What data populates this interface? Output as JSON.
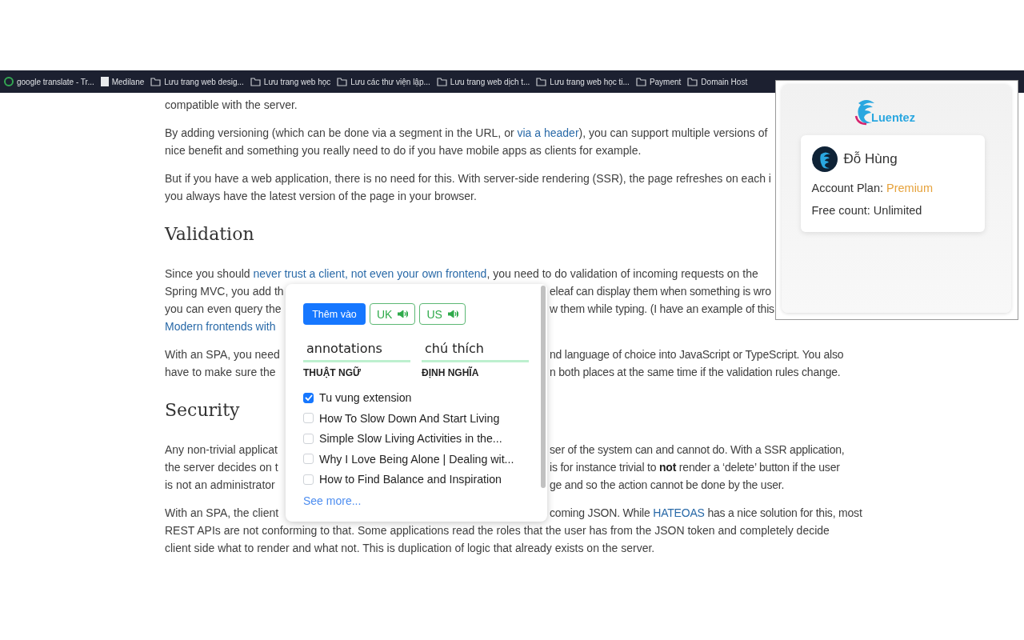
{
  "bookmarks_bar": {
    "items": [
      {
        "kind": "site",
        "label": "google translate - Tr..."
      },
      {
        "kind": "page",
        "label": "Medilane"
      },
      {
        "kind": "folder",
        "label": "Lưu trang web desig..."
      },
      {
        "kind": "folder",
        "label": "Lưu trang web học"
      },
      {
        "kind": "folder",
        "label": "Lưu các thư viện lập..."
      },
      {
        "kind": "folder",
        "label": "Lưu trang web dịch t..."
      },
      {
        "kind": "folder",
        "label": "Lưu trang web học ti..."
      },
      {
        "kind": "folder",
        "label": "Payment"
      },
      {
        "kind": "folder",
        "label": "Domain Host"
      }
    ]
  },
  "article": {
    "blocks": [
      {
        "kind": "paragraph",
        "lines": [
          {
            "parts": [
              {
                "kind": "text",
                "text": "compatible with the server."
              }
            ]
          }
        ]
      },
      {
        "kind": "paragraph",
        "lines": [
          {
            "parts": [
              {
                "kind": "text",
                "text": "By adding versioning (which can be done via a segment in the URL, or "
              },
              {
                "kind": "link",
                "text": "via a header"
              },
              {
                "kind": "text",
                "text": "), you can support multiple versions of"
              }
            ]
          },
          {
            "parts": [
              {
                "kind": "text",
                "text": "nice benefit and something you really need to do if you have mobile apps as clients for example."
              }
            ]
          }
        ]
      },
      {
        "kind": "paragraph",
        "lines": [
          {
            "parts": [
              {
                "kind": "text",
                "text": "But if you have a web application, there is no need for this. With server-side rendering (SSR), the page refreshes on each i"
              }
            ]
          },
          {
            "parts": [
              {
                "kind": "text",
                "text": "you always have the latest version of the page in your browser."
              }
            ]
          }
        ]
      },
      {
        "kind": "heading",
        "text": "Validation"
      },
      {
        "kind": "paragraph",
        "lines": [
          {
            "parts": [
              {
                "kind": "text",
                "text": "Since you should "
              },
              {
                "kind": "link",
                "text": "never trust a client, not even your own frontend"
              },
              {
                "kind": "text",
                "text": ", you need to do validation of incoming requests on the"
              }
            ]
          },
          {
            "parts": [
              {
                "kind": "text",
                "text": "Spring MVC, you add th"
              }
            ],
            "right_parts": [
              {
                "kind": "text",
                "text": "eleaf can display them when something is wro"
              }
            ]
          },
          {
            "parts": [
              {
                "kind": "text",
                "text": "you can even query the"
              }
            ],
            "right_parts": [
              {
                "kind": "text",
                "text": "w them while typing. (I have an example of this"
              }
            ]
          },
          {
            "parts": [
              {
                "kind": "link",
                "text": "Modern frontends with"
              }
            ]
          }
        ]
      },
      {
        "kind": "paragraph",
        "lines": [
          {
            "parts": [
              {
                "kind": "text",
                "text": "With an SPA, you need"
              }
            ],
            "right_parts": [
              {
                "kind": "text",
                "text": "nd language of choice into JavaScript or TypeScript. You also"
              }
            ]
          },
          {
            "parts": [
              {
                "kind": "text",
                "text": "have to make sure the"
              }
            ],
            "right_parts": [
              {
                "kind": "text",
                "text": "n both places at the same time if the validation rules change."
              }
            ]
          }
        ]
      },
      {
        "kind": "heading",
        "text": "Security"
      },
      {
        "kind": "paragraph",
        "lines": [
          {
            "parts": [
              {
                "kind": "text",
                "text": "Any non-trivial applicat"
              }
            ],
            "right_parts": [
              {
                "kind": "text",
                "text": "ser of the system can and cannot do. With a SSR application,"
              }
            ]
          },
          {
            "parts": [
              {
                "kind": "text",
                "text": "the server decides on t"
              }
            ],
            "right_parts": [
              {
                "kind": "text",
                "text": "is for instance trivial to **not** render a ‘delete’ button if the user"
              }
            ]
          },
          {
            "parts": [
              {
                "kind": "text",
                "text": "is not an administrator"
              }
            ],
            "right_parts": [
              {
                "kind": "text",
                "text": "ge and so the action cannot be done by the user."
              }
            ]
          }
        ]
      },
      {
        "kind": "paragraph",
        "lines": [
          {
            "parts": [
              {
                "kind": "text",
                "text": "With an SPA, the client"
              }
            ],
            "right_parts": [
              {
                "kind": "text",
                "text": "coming JSON. While "
              },
              {
                "kind": "link",
                "text": "HATEOAS"
              },
              {
                "kind": "text",
                "text": " has a nice solution for this, most"
              }
            ]
          },
          {
            "parts": [
              {
                "kind": "text",
                "text": "REST APIs are not conforming to that. Some applications read the roles that the user has from the JSON token and completely decide"
              }
            ]
          },
          {
            "parts": [
              {
                "kind": "text",
                "text": "client side what to render and what not. This is duplication of logic that already exists on the server."
              }
            ]
          }
        ]
      }
    ]
  },
  "word_popup": {
    "add_button": "Thêm vào",
    "pronunciations": [
      {
        "label": "UK"
      },
      {
        "label": "US"
      }
    ],
    "term": {
      "value": "annotations",
      "label": "THUẬT NGỮ"
    },
    "definition": {
      "value": "chú thích",
      "label": "ĐỊNH NGHĨA"
    },
    "lists": [
      {
        "label": "Tu vung extension",
        "checked": true
      },
      {
        "label": "How To Slow Down And Start Living",
        "checked": false
      },
      {
        "label": "Simple Slow Living Activities in the...",
        "checked": false
      },
      {
        "label": "Why I Love Being Alone | Dealing wit...",
        "checked": false
      },
      {
        "label": "How to Find Balance and Inspiration",
        "checked": false
      }
    ],
    "see_more": "See more..."
  },
  "account_panel": {
    "logo_text": "Luentez",
    "user_name": "Đỗ Hùng",
    "plan_label": "Account Plan:",
    "plan_value": "Premium",
    "free_count": "Free count: Unlimited"
  }
}
